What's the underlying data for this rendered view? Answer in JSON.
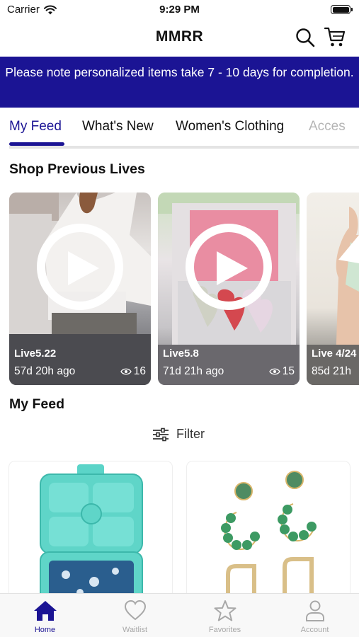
{
  "status_bar": {
    "carrier": "Carrier",
    "time": "9:29 PM"
  },
  "header": {
    "title": "MMRR",
    "icons": [
      "search-icon",
      "cart-icon"
    ]
  },
  "banner": {
    "text": "Please note personalized items take 7 - 10 days for completion."
  },
  "category_tabs": [
    {
      "label": "My Feed",
      "active": true
    },
    {
      "label": "What's New",
      "active": false
    },
    {
      "label": "Women's Clothing",
      "active": false
    },
    {
      "label": "Acces",
      "active": false
    }
  ],
  "previous_lives": {
    "title": "Shop Previous Lives",
    "cards": [
      {
        "name": "Live5.22",
        "ago": "57d 20h ago",
        "views": "16"
      },
      {
        "name": "Live5.8",
        "ago": "71d 21h ago",
        "views": "15"
      },
      {
        "name": "Live 4/24",
        "ago": "85d 21h",
        "views": ""
      }
    ]
  },
  "feed": {
    "title": "My Feed",
    "filter_label": "Filter",
    "products": [
      {
        "image": "teal bento lunch box"
      },
      {
        "image": "green beaded earrings"
      }
    ]
  },
  "bottom_tabs": [
    {
      "label": "Home",
      "icon": "home-icon",
      "active": true
    },
    {
      "label": "Waitlist",
      "icon": "heart-icon",
      "active": false
    },
    {
      "label": "Favorites",
      "icon": "star-icon",
      "active": false
    },
    {
      "label": "Account",
      "icon": "person-icon",
      "active": false
    }
  ],
  "colors": {
    "brand": "#1b1494",
    "banner_text": "#ffffff",
    "inactive": "#a8a8a8"
  }
}
